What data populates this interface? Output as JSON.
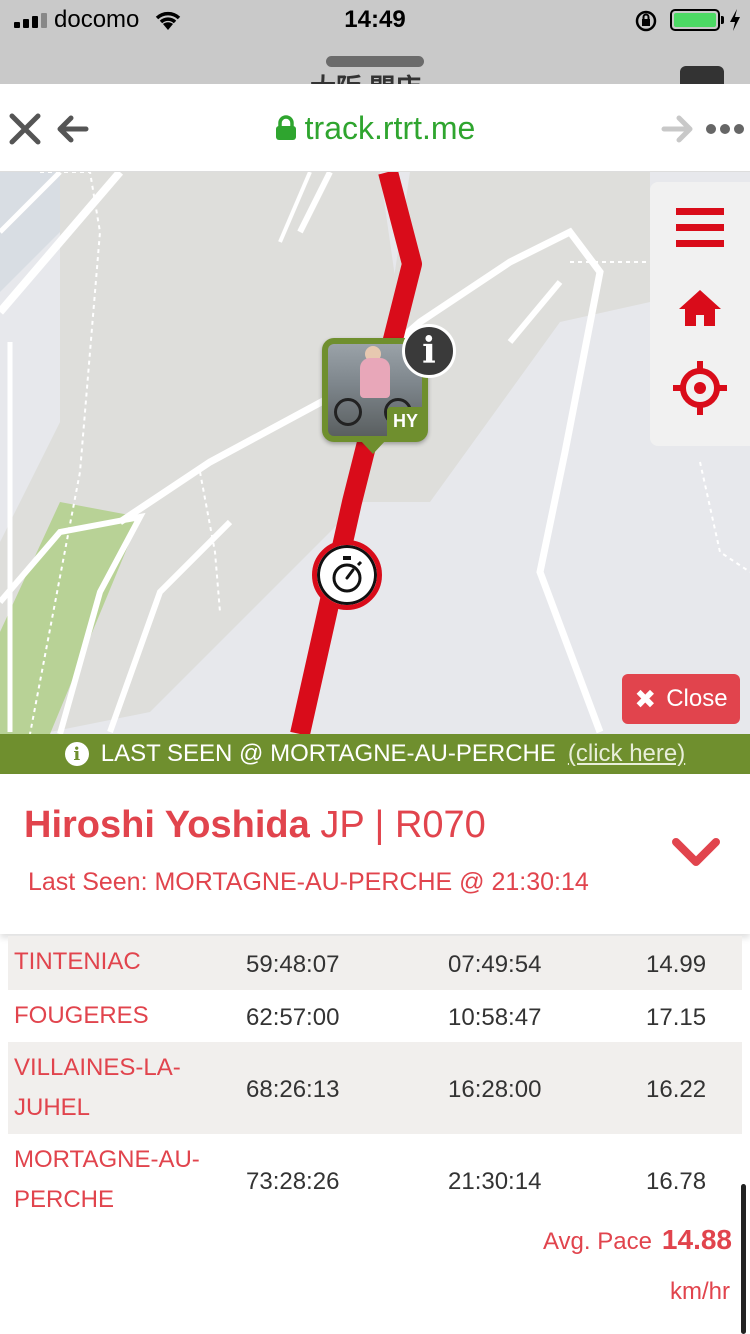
{
  "status_bar": {
    "carrier": "docomo",
    "time": "14:49"
  },
  "browser": {
    "url": "track.rtrt.me",
    "behind_title": "大阪 開店"
  },
  "map": {
    "close_label": "Close",
    "runner_initials": "HY",
    "info_glyph": "i"
  },
  "last_seen_bar": {
    "text": "LAST SEEN @ MORTAGNE-AU-PERCHE",
    "link": "(click here)"
  },
  "athlete": {
    "name": "Hiroshi Yoshida",
    "country_bib": "JP | R070",
    "last_seen": "Last Seen: MORTAGNE-AU-PERCHE @ 21:30:14"
  },
  "splits": [
    {
      "location": "TINTENIAC",
      "elapsed": "59:48:07",
      "time_of_day": "07:49:54",
      "pace": "14.99"
    },
    {
      "location": "FOUGERES",
      "elapsed": "62:57:00",
      "time_of_day": "10:58:47",
      "pace": "17.15"
    },
    {
      "location": "VILLAINES-LA-JUHEL",
      "location_lines": [
        "VILLAINES-LA-",
        "JUHEL"
      ],
      "elapsed": "68:26:13",
      "time_of_day": "16:28:00",
      "pace": "16.22"
    },
    {
      "location": "MORTAGNE-AU-PERCHE",
      "location_lines": [
        "MORTAGNE-AU-",
        "PERCHE"
      ],
      "elapsed": "73:28:26",
      "time_of_day": "21:30:14",
      "pace": "16.78"
    }
  ],
  "avg_pace": {
    "label": "Avg. Pace",
    "value": "14.88",
    "unit": "km/hr"
  },
  "colors": {
    "accent_red": "#e1444d",
    "route_red": "#d90c1a",
    "marker_green": "#6f8f2e",
    "url_green": "#2fa52f"
  },
  "icons": {
    "close": "close-icon",
    "back": "back-arrow-icon",
    "lock": "lock-icon",
    "forward": "forward-arrow-icon",
    "more": "more-icon",
    "menu": "hamburger-menu-icon",
    "home": "home-icon",
    "locate": "crosshair-icon",
    "timer": "stopwatch-icon",
    "info": "info-icon",
    "chevron": "chevron-down-icon"
  }
}
